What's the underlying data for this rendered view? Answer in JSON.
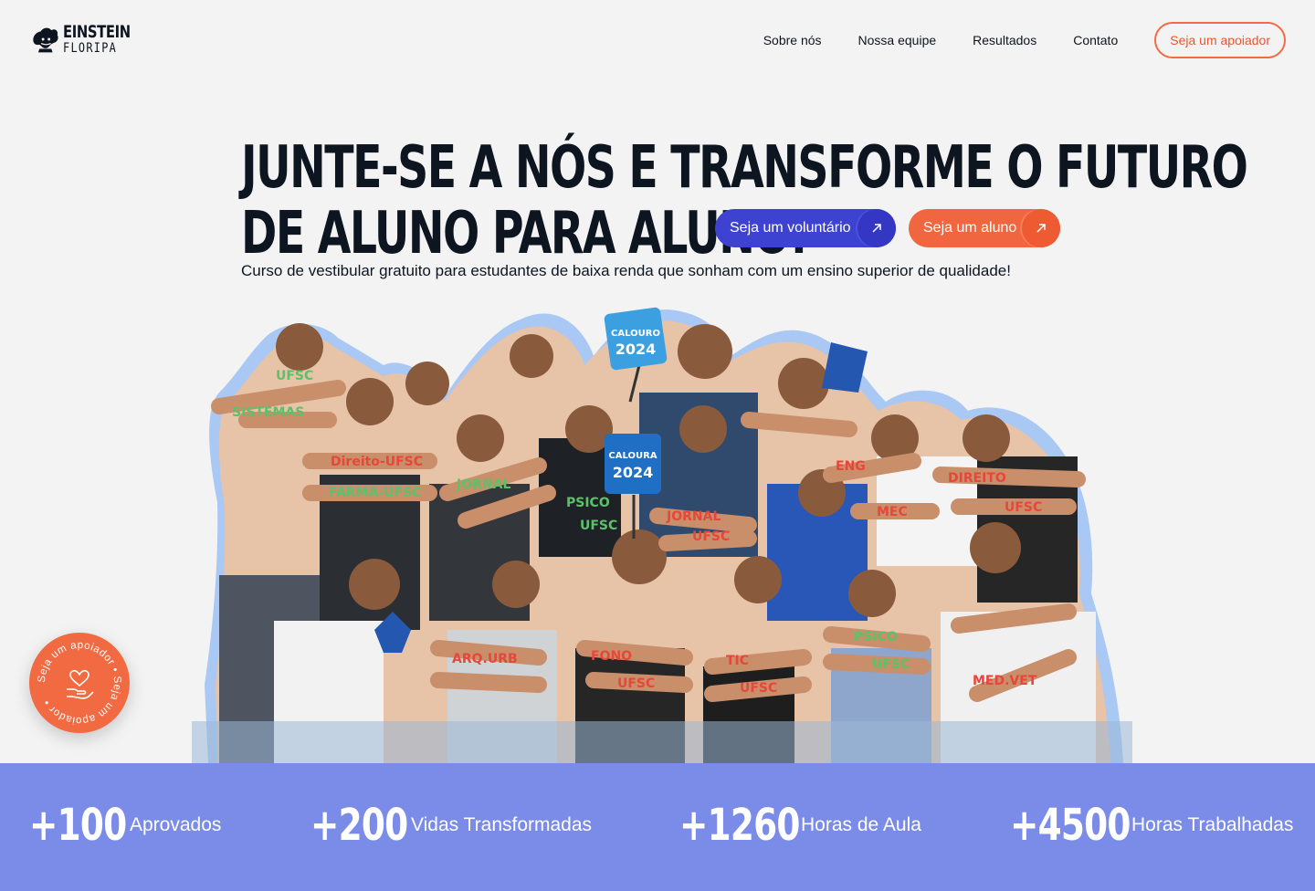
{
  "brand": {
    "line1": "EINSTEIN",
    "line2": "FLORIPA"
  },
  "nav": {
    "items": [
      {
        "label": "Sobre nós"
      },
      {
        "label": "Nossa equipe"
      },
      {
        "label": "Resultados"
      },
      {
        "label": "Contato"
      }
    ],
    "cta_label": "Seja um apoiador"
  },
  "hero": {
    "title_line1": "JUNTE-SE A NÓS E TRANSFORME O FUTURO",
    "title_line2": "DE ALUNO PARA ALUNO!",
    "subtitle": "Curso de vestibular gratuito para estudantes de baixa renda que sonham com um ensino superior de qualidade!",
    "volunteer_button": "Seja um voluntário",
    "student_button": "Seja um aluno",
    "arrow_icon": "arrow-up-right-icon"
  },
  "photo": {
    "sign_1_line1": "CALOURO",
    "sign_1_line2": "2024",
    "sign_2_line1": "CALOURA",
    "sign_2_line2": "2024",
    "arm_labels": [
      "UFSC",
      "SISTEMAS",
      "Direito-UFSC",
      "FARMA-UFSC",
      "JORNAL",
      "PSICO",
      "UFSC",
      "JORNAL",
      "UFSC",
      "ENG",
      "MEC",
      "DIREITO",
      "UFSC",
      "ARQ.URB",
      "FONO",
      "UFSC",
      "TIC",
      "UFSC",
      "PSICO",
      "UFSC",
      "MED.VET"
    ]
  },
  "badge": {
    "text": "Seja um apoiador •  Seja um apoiador • ",
    "icon": "heart-hand-icon"
  },
  "stats": [
    {
      "number": "+100",
      "label": "Aprovados"
    },
    {
      "number": "+200",
      "label": "Vidas Transformadas"
    },
    {
      "number": "+1260",
      "label": "Horas de Aula"
    },
    {
      "number": "+4500",
      "label": "Horas Trabalhadas"
    }
  ],
  "colors": {
    "accent_orange": "#f26b43",
    "accent_blue": "#3d43d0",
    "stats_background": "#7a8ce8",
    "text_dark": "#0d1520"
  }
}
